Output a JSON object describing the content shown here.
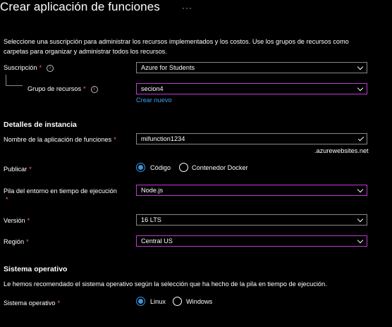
{
  "page": {
    "title": "Crear aplicación de funciones",
    "more": "···"
  },
  "intro": {
    "description": "Seleccione una suscripción para administrar los recursos implementados y los costos. Use los grupos de recursos como carpetas para organizar y administrar todos los recursos."
  },
  "subscription": {
    "label": "Suscripción",
    "required": "*",
    "info": "i",
    "value": "Azure for Students"
  },
  "resource_group": {
    "label": "Grupo de recursos",
    "required": "*",
    "info": "i",
    "value": "secion4",
    "create_new": "Crear nuevo"
  },
  "instance": {
    "heading": "Detalles de instancia",
    "app_name_label": "Nombre de la aplicación de funciones",
    "app_name_required": "*",
    "app_name_value": "mifunction1234",
    "suffix": ".azurewebsites.net",
    "publish_label": "Publicar",
    "publish_required": "*",
    "publish_options": [
      "Código",
      "Contenedor Docker"
    ],
    "publish_selected": "Código",
    "stack_label": "Pila del entorno en tiempo de ejecución",
    "stack_required": "*",
    "stack_value": "Node.js",
    "version_label": "Versión",
    "version_required": "*",
    "version_value": "16 LTS",
    "region_label": "Región",
    "region_required": "*",
    "region_value": "Central US"
  },
  "os": {
    "heading": "Sistema operativo",
    "description": "Le hemos recomendado el sistema operativo según la selección que ha hecho de la pila en tiempo de ejecución.",
    "label": "Sistema operativo",
    "required": "*",
    "options": [
      "Linux",
      "Windows"
    ],
    "selected": "Linux"
  },
  "colors": {
    "background": "#000000",
    "focus_border": "#c239d8",
    "link": "#3aa0f3",
    "required": "#f1707b",
    "radio_selected": "#3a96dd"
  }
}
